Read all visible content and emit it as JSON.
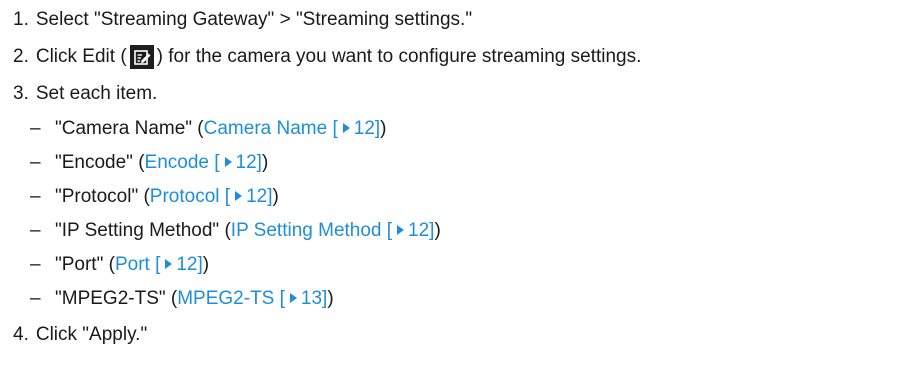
{
  "steps": [
    {
      "num": "1.",
      "text": "Select \"Streaming Gateway\" > \"Streaming settings.\""
    },
    {
      "num": "2.",
      "text_before": "Click Edit (",
      "icon": "edit-icon",
      "text_after": ") for the camera you want to configure streaming settings."
    },
    {
      "num": "3.",
      "text": "Set each item.",
      "subitems": [
        {
          "label": "\"Camera Name\" (",
          "link_text": "Camera Name [",
          "page": "12]",
          "close": ")"
        },
        {
          "label": "\"Encode\" (",
          "link_text": "Encode [",
          "page": "12]",
          "close": ")"
        },
        {
          "label": "\"Protocol\" (",
          "link_text": "Protocol [",
          "page": "12]",
          "close": ")"
        },
        {
          "label": "\"IP Setting Method\" (",
          "link_text": "IP Setting Method [",
          "page": "12]",
          "close": ")"
        },
        {
          "label": "\"Port\" (",
          "link_text": "Port [",
          "page": "12]",
          "close": ")"
        },
        {
          "label": "\"MPEG2-TS\" (",
          "link_text": "MPEG2-TS [",
          "page": "13]",
          "close": ")"
        }
      ]
    },
    {
      "num": "4.",
      "text": "Click \"Apply.\""
    }
  ],
  "dash": "–",
  "colors": {
    "text": "#1a1a1a",
    "link": "#1e8ed8",
    "icon_bg": "#1d1d1d"
  }
}
